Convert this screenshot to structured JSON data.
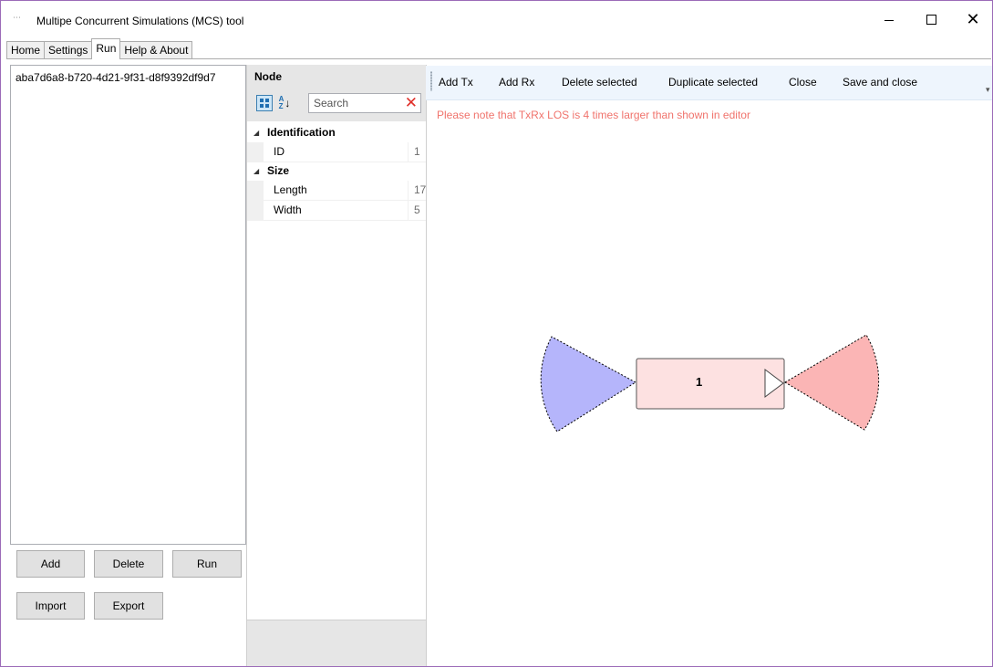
{
  "window": {
    "title": "Multipe Concurrent Simulations (MCS) tool",
    "controls": {
      "minimize": "–",
      "maximize": "☐",
      "close": "✕"
    }
  },
  "tabs": [
    {
      "label": "Home",
      "active": false
    },
    {
      "label": "Settings",
      "active": false
    },
    {
      "label": "Run",
      "active": true
    },
    {
      "label": "Help & About",
      "active": false
    }
  ],
  "simulations": {
    "items": [
      "aba7d6a8-b720-4d21-9f31-d8f9392df9d7"
    ]
  },
  "buttons": {
    "add": "Add",
    "delete": "Delete",
    "run": "Run",
    "import": "Import",
    "export": "Export"
  },
  "property_grid": {
    "title": "Node",
    "search_placeholder": "Search",
    "categories": [
      {
        "name": "Identification",
        "properties": [
          {
            "name": "ID",
            "value": "1"
          }
        ]
      },
      {
        "name": "Size",
        "properties": [
          {
            "name": "Length",
            "value": "17"
          },
          {
            "name": "Width",
            "value": "5"
          }
        ]
      }
    ]
  },
  "toolbar": {
    "add_tx": "Add Tx",
    "add_rx": "Add Rx",
    "delete_selected": "Delete selected",
    "duplicate_selected": "Duplicate selected",
    "close": "Close",
    "save_and_close": "Save and close"
  },
  "editor": {
    "notice": "Please note that TxRx LOS is 4 times larger than shown in editor",
    "node": {
      "label": "1",
      "fill_color": "#fde1e1",
      "rx_cone_color": "#b5b5fb",
      "tx_cone_color": "#fbb5b5"
    }
  },
  "colors": {
    "notice": "#f0736c",
    "toolbar_bg": "#eef5fd",
    "window_border": "#9b6bb8"
  }
}
